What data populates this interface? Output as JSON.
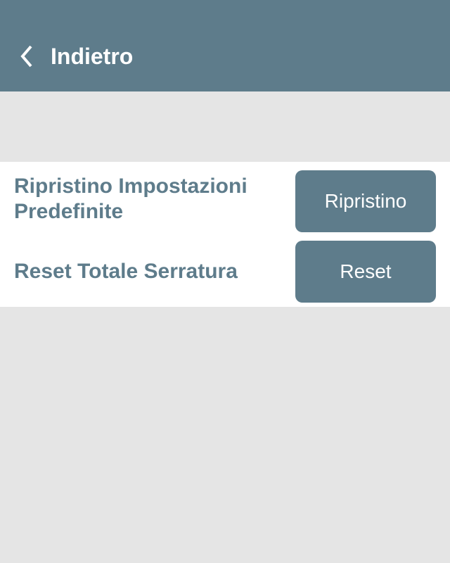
{
  "header": {
    "title": "Indietro"
  },
  "settings": {
    "rows": [
      {
        "label": "Ripristino Impostazioni Predefinite",
        "button": "Ripristino"
      },
      {
        "label": "Reset Totale Serratura",
        "button": "Reset"
      }
    ]
  }
}
